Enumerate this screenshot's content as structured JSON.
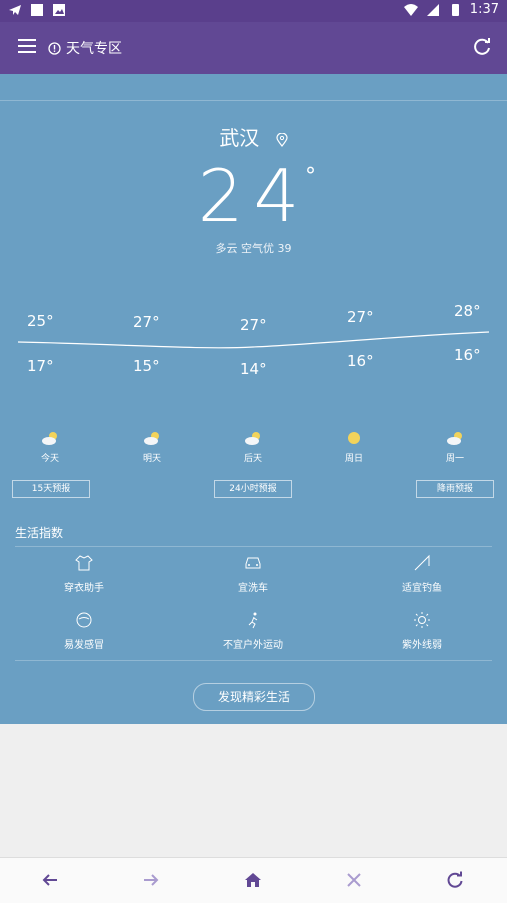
{
  "status": {
    "time": "1:37"
  },
  "appbar": {
    "title": "天气专区"
  },
  "weather": {
    "city": "武汉",
    "temperature": "24",
    "degree_symbol": "°",
    "condition": "多云 空气优 39"
  },
  "trend": {
    "highs": [
      "25°",
      "27°",
      "27°",
      "27°",
      "28°"
    ],
    "lows": [
      "17°",
      "15°",
      "14°",
      "16°",
      "16°"
    ]
  },
  "forecast_days": [
    {
      "label": "今天",
      "icon": "partly-cloudy-icon"
    },
    {
      "label": "明天",
      "icon": "partly-cloudy-icon"
    },
    {
      "label": "后天",
      "icon": "partly-cloudy-icon"
    },
    {
      "label": "周日",
      "icon": "sun-icon"
    },
    {
      "label": "周一",
      "icon": "partly-cloudy-icon"
    }
  ],
  "forecast_buttons": [
    "15天预报",
    "24小时预报",
    "降雨预报"
  ],
  "life": {
    "title": "生活指数",
    "items": [
      "穿衣助手",
      "宜洗车",
      "适宜钓鱼",
      "易发感冒",
      "不宜户外运动",
      "紫外线弱"
    ]
  },
  "discover_label": "发现精彩生活",
  "colors": {
    "appbar": "#614894",
    "content": "#6a9fc3",
    "accent": "#614894"
  }
}
